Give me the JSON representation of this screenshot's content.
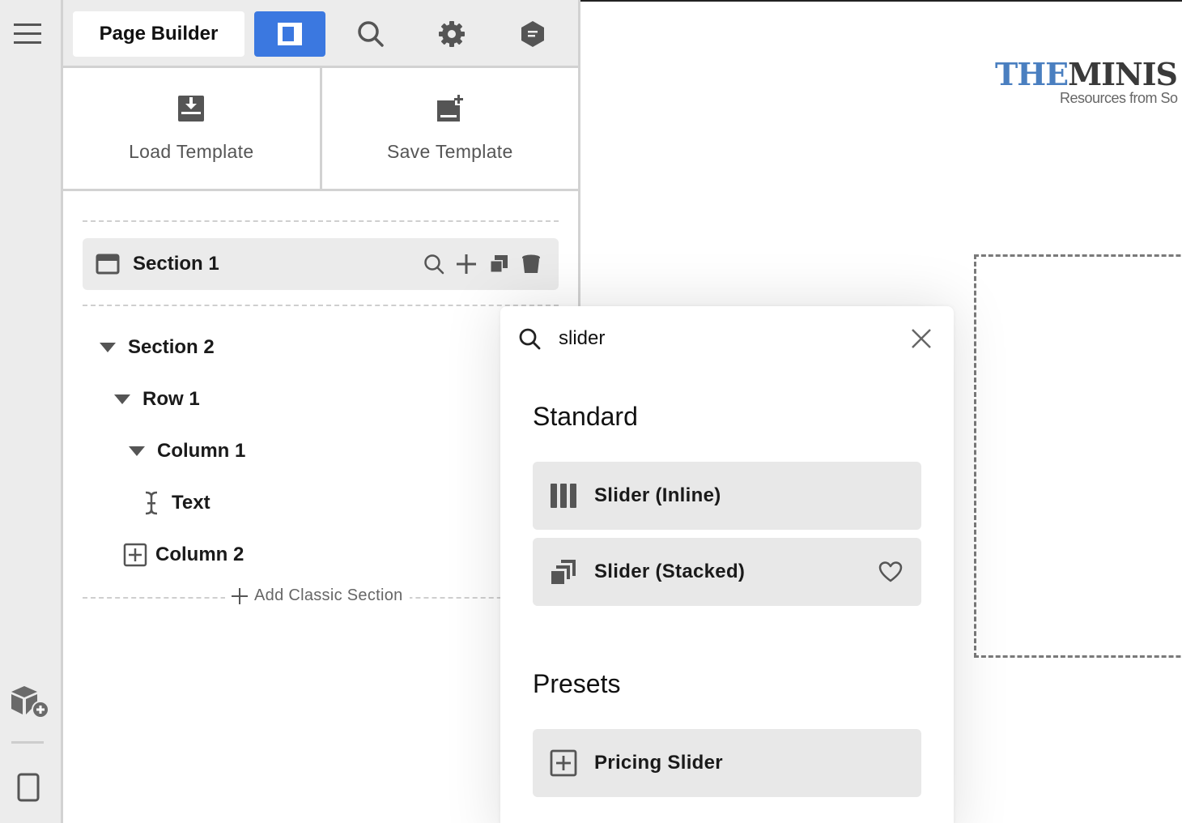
{
  "toolbar": {
    "title": "Page Builder",
    "buttons": [
      {
        "icon": "panel-layout-icon",
        "active": true
      },
      {
        "icon": "search-icon",
        "active": false
      },
      {
        "icon": "gear-icon",
        "active": false
      },
      {
        "icon": "info-hexagon-icon",
        "active": false
      }
    ]
  },
  "templates": {
    "load_label": "Load Template",
    "save_label": "Save Template"
  },
  "outline": {
    "section1": {
      "label": "Section 1",
      "actions": [
        "search-icon",
        "plus-icon",
        "copy-icon",
        "trash-icon"
      ]
    },
    "section2": {
      "label": "Section 2"
    },
    "row1": {
      "label": "Row 1"
    },
    "column1": {
      "label": "Column 1"
    },
    "text": {
      "label": "Text"
    },
    "column2": {
      "label": "Column 2"
    },
    "add_classic_label": "Add Classic Section"
  },
  "canvas": {
    "logo_part1": "THE",
    "logo_part2": "MINIS",
    "logo_tagline": "Resources from So"
  },
  "search_popup": {
    "query": "slider",
    "standard_heading": "Standard",
    "standard_results": [
      {
        "label": "Slider (Inline)",
        "icon": "slider-columns-icon"
      },
      {
        "label": "Slider (Stacked)",
        "icon": "stacked-layers-icon",
        "favorite": "heart-icon"
      }
    ],
    "presets_heading": "Presets",
    "preset_results": [
      {
        "label": "Pricing Slider",
        "icon": "plus-square-icon"
      }
    ]
  },
  "colors": {
    "accent": "#3b78e0",
    "rail_bg": "#ececec",
    "row_bg": "#ebebeb",
    "result_bg": "#e8e8e8"
  }
}
